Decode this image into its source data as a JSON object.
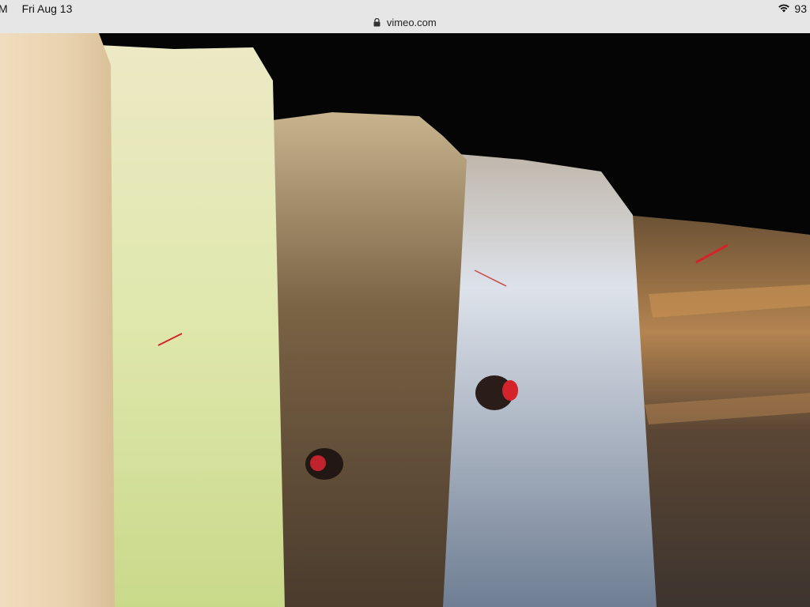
{
  "status_bar": {
    "time": "M",
    "date": "Fri Aug 13",
    "battery": "93",
    "wifi_icon": "wifi-icon"
  },
  "browser": {
    "url": "vimeo.com",
    "lock_icon": "lock-icon"
  },
  "media": {
    "description_colors": {
      "background": "#050505",
      "bone_cortex": "#e7d2b0",
      "fat_yellow": "#d7e3a0",
      "muscle_brown": "#6c5134",
      "fascia_white": "#cfd4dc",
      "vessel_red": "#d5232b"
    }
  }
}
